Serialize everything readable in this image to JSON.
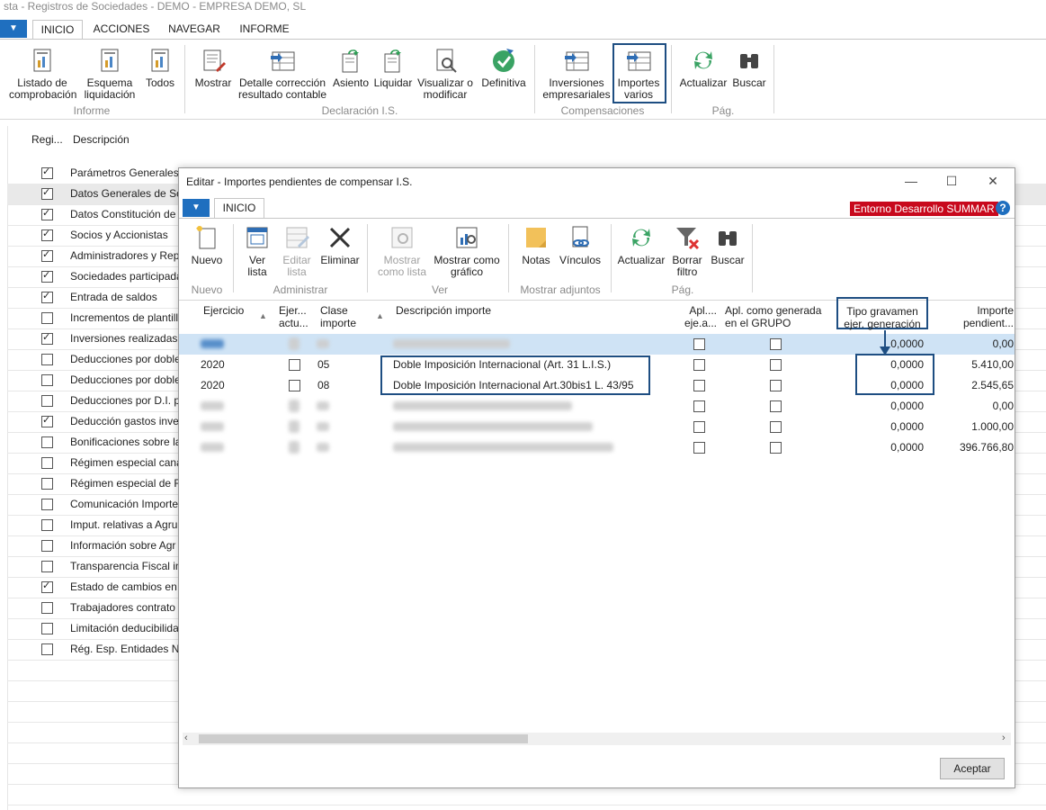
{
  "window": {
    "title": "sta - Registros de Sociedades - DEMO - EMPRESA DEMO, SL"
  },
  "tabs": [
    "INICIO",
    "ACCIONES",
    "NAVEGAR",
    "INFORME"
  ],
  "ribbon": {
    "informe_btns": [
      "Listado de comprobación",
      "Esquema liquidación",
      "Todos"
    ],
    "declaracion_btns": [
      "Mostrar",
      "Detalle corrección resultado contable",
      "Asiento",
      "Liquidar",
      "Visualizar o modificar",
      "Definitiva"
    ],
    "compensaciones_btns": [
      "Inversiones empresariales",
      "Importes varios"
    ],
    "pag_btns": [
      "Actualizar",
      "Buscar"
    ],
    "groups": {
      "informe": "Informe",
      "declaracion": "Declaración I.S.",
      "compensaciones": "Compensaciones",
      "pag": "Pág."
    }
  },
  "list": {
    "headers": {
      "registro": "Regi...",
      "descripcion": "Descripción"
    },
    "rows": [
      {
        "label": "Parámetros Generales",
        "checked": true
      },
      {
        "label": "Datos Generales de Soc",
        "checked": true
      },
      {
        "label": "Datos Constitución de",
        "checked": true
      },
      {
        "label": "Socios y Accionistas",
        "checked": true
      },
      {
        "label": "Administradores y Repr",
        "checked": true
      },
      {
        "label": "Sociedades participada",
        "checked": true
      },
      {
        "label": "Entrada de saldos",
        "checked": true
      },
      {
        "label": "Incrementos de plantill",
        "checked": false
      },
      {
        "label": "Inversiones realizadas c",
        "checked": true
      },
      {
        "label": "Deducciones por doble",
        "checked": false
      },
      {
        "label": "Deducciones por doble",
        "checked": false
      },
      {
        "label": "Deducciones por D.I. p",
        "checked": false
      },
      {
        "label": "Deducción gastos inves",
        "checked": true
      },
      {
        "label": "Bonificaciones sobre la",
        "checked": false
      },
      {
        "label": "Régimen especial cana",
        "checked": false
      },
      {
        "label": "Régimen especial de Fu",
        "checked": false
      },
      {
        "label": "Comunicación Importe",
        "checked": false
      },
      {
        "label": "Imput. relativas a Agru",
        "checked": false
      },
      {
        "label": "Información sobre Agr",
        "checked": false
      },
      {
        "label": "Transparencia Fiscal int",
        "checked": false
      },
      {
        "label": "Estado de cambios en e",
        "checked": true
      },
      {
        "label": "Trabajadores contrato i",
        "checked": false
      },
      {
        "label": "Limitación deducibilida",
        "checked": false
      },
      {
        "label": "Rég. Esp. Entidades Nav",
        "checked": false
      }
    ]
  },
  "dialog": {
    "title": "Editar - Importes pendientes de compensar I.S.",
    "tab": "INICIO",
    "env_badge": "Entorno Desarrollo SUMMAR",
    "help": "?",
    "ribbon": {
      "nuevo": "Nuevo",
      "ver_lista": "Ver lista",
      "editar_lista": "Editar lista",
      "eliminar": "Eliminar",
      "mostrar_como_lista": "Mostrar como lista",
      "mostrar_como_grafico": "Mostrar como gráfico",
      "notas": "Notas",
      "vinculos": "Vínculos",
      "actualizar": "Actualizar",
      "borrar_filtro": "Borrar filtro",
      "buscar": "Buscar",
      "groups": {
        "nuevo": "Nuevo",
        "administrar": "Administrar",
        "ver": "Ver",
        "adjuntos": "Mostrar adjuntos",
        "pag": "Pág."
      }
    },
    "columns": {
      "ejercicio": "Ejercicio",
      "ejer_actual": "Ejer... actu...",
      "clase_importe": "Clase importe",
      "descripcion": "Descripción importe",
      "apl_ej": "Apl.... eje.a...",
      "apl_grupo": "Apl. como generada en el GRUPO",
      "tipo_gravamen": "Tipo gravamen ejer. generación",
      "importe_pendiente": "Importe pendient..."
    },
    "rows": [
      {
        "ejercicio": "",
        "clase": "",
        "descripcion": "",
        "tipo": "0,0000",
        "importe": "0,00",
        "blurred": true,
        "selected": true
      },
      {
        "ejercicio": "2020",
        "clase": "05",
        "descripcion": "Doble Imposición Internacional (Art. 31 L.I.S.)",
        "tipo": "0,0000",
        "importe": "5.410,00",
        "blurred": false
      },
      {
        "ejercicio": "2020",
        "clase": "08",
        "descripcion": "Doble Imposición Internacional Art.30bis1 L. 43/95",
        "tipo": "0,0000",
        "importe": "2.545,65",
        "blurred": false
      },
      {
        "ejercicio": "",
        "clase": "",
        "descripcion": "",
        "tipo": "0,0000",
        "importe": "0,00",
        "blurred": true
      },
      {
        "ejercicio": "",
        "clase": "",
        "descripcion": "",
        "tipo": "0,0000",
        "importe": "1.000,00",
        "blurred": true
      },
      {
        "ejercicio": "",
        "clase": "",
        "descripcion": "",
        "tipo": "0,0000",
        "importe": "396.766,80",
        "blurred": true
      }
    ],
    "ok": "Aceptar"
  },
  "colors": {
    "accent": "#1f6fbf",
    "highlight_box": "#1e4e82",
    "env_badge": "#c8091d",
    "selected_row": "#cfe3f5"
  }
}
